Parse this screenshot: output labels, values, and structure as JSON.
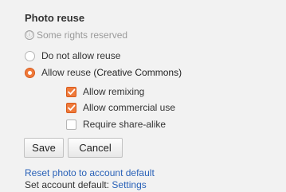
{
  "photo_reuse": {
    "title": "Photo reuse",
    "rights_icon": "cc-circle-icon",
    "rights_text": "Some rights reserved",
    "options": [
      {
        "label": "Do not allow reuse",
        "checked": false
      },
      {
        "label_prefix": "Allow reuse ",
        "label_strong": "(Creative Commons)",
        "checked": true
      }
    ],
    "suboptions": [
      {
        "label": "Allow remixing",
        "checked": true
      },
      {
        "label": "Allow commercial use",
        "checked": true
      },
      {
        "label": "Require share-alike",
        "checked": false
      }
    ],
    "buttons": {
      "save": "Save",
      "cancel": "Cancel"
    },
    "reset_link": "Reset photo to account default",
    "default_prefix": "Set account default: ",
    "default_link": "Settings",
    "colors": {
      "accent": "#ef7a3b",
      "link": "#2a62b8",
      "background": "#f2f2f2"
    }
  }
}
